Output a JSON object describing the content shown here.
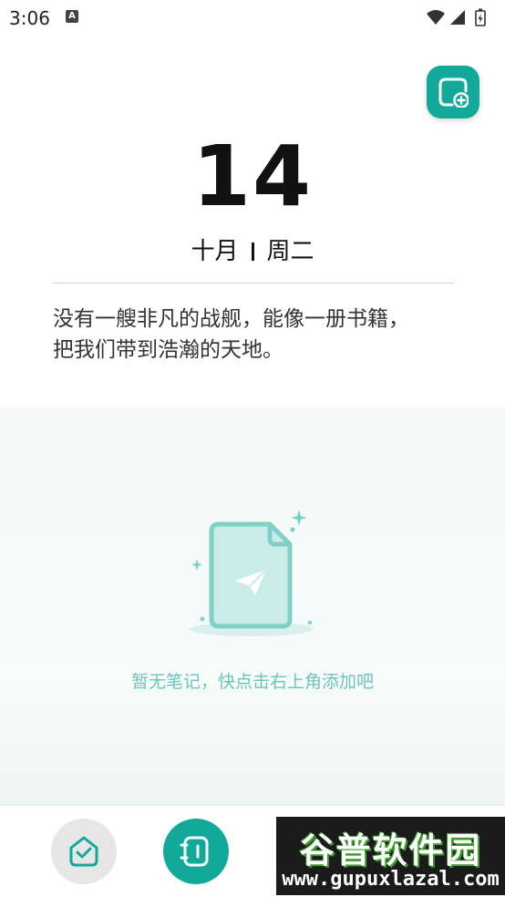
{
  "status_bar": {
    "time": "3:06",
    "notification_letter": "A"
  },
  "header": {
    "day": "14",
    "month": "十月",
    "weekday": "周二"
  },
  "quote": {
    "line1": "没有一艘非凡的战舰，能像一册书籍，",
    "line2": "把我们带到浩瀚的天地。"
  },
  "notes": {
    "empty_text": "暂无笔记，快点击右上角添加吧"
  },
  "watermark": {
    "title": "谷普软件园",
    "url": "www.gupuxlazal.com"
  },
  "colors": {
    "accent": "#12a99a",
    "empty_text": "#6cc5bc"
  },
  "icons": {
    "add": "add-note-icon",
    "home": "home-check-icon",
    "notebook": "notebook-icon",
    "empty": "empty-document-icon"
  }
}
